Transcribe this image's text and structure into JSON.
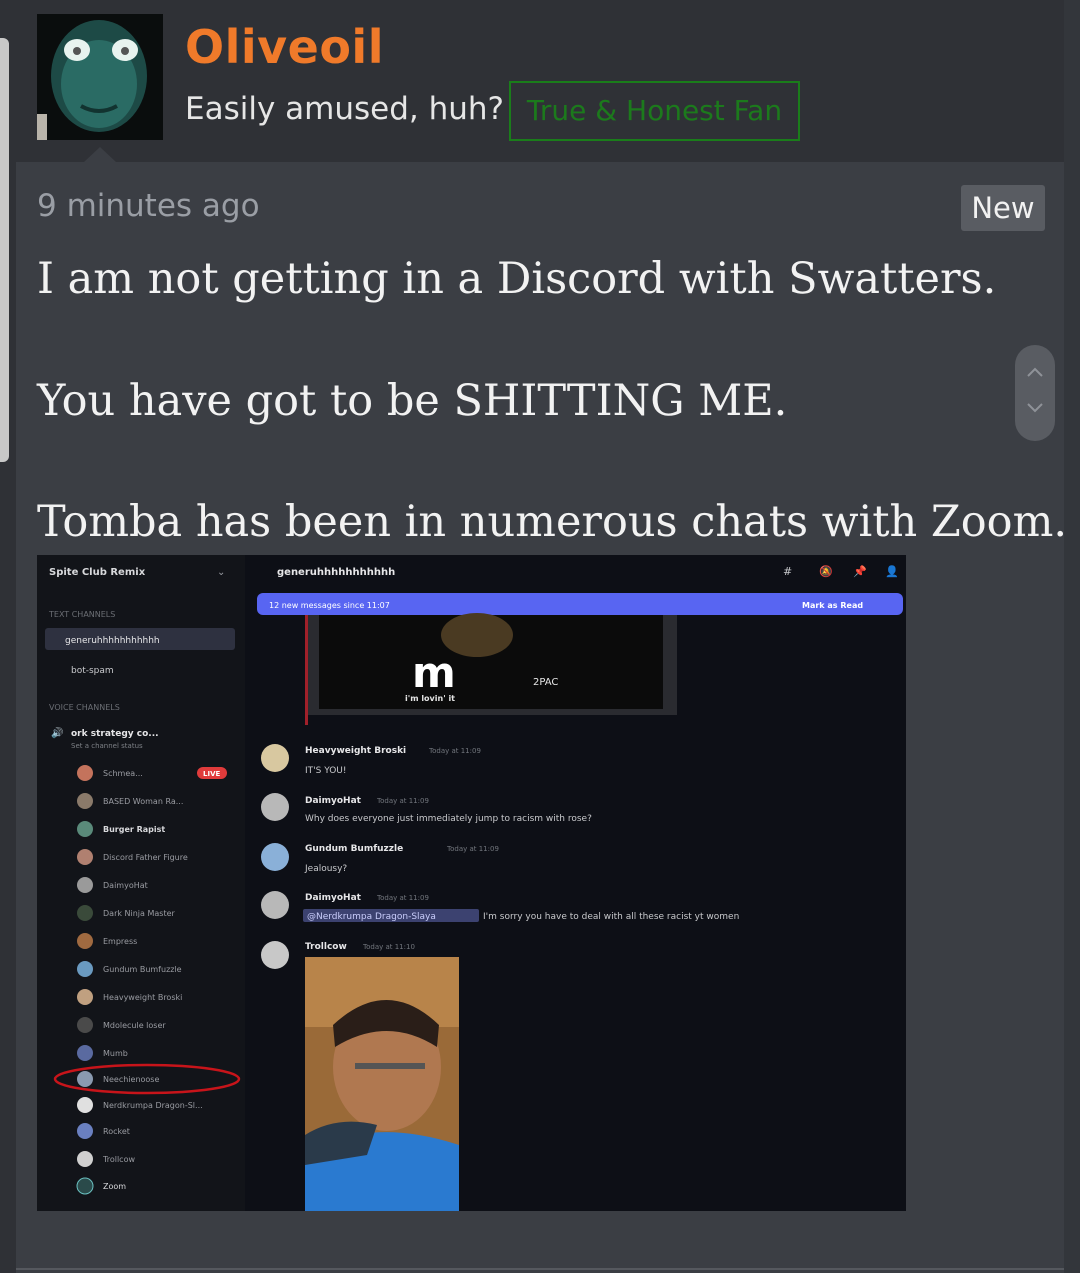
{
  "post": {
    "username": "Oliveoil",
    "user_title": "Easily amused, huh?",
    "banner": "True & Honest Fan",
    "timestamp": "9 minutes ago",
    "new_badge": "New",
    "lines": [
      "I am not getting in a Discord with Swatters.",
      "You have got to be SHITTING ME.",
      "Tomba has been in numerous chats with Zoom."
    ]
  },
  "screenshot": {
    "server_name": "Spite Club Remix",
    "channel_name": "generuhhhhhhhhhhh",
    "new_messages_bar": "12 new messages since 11:07",
    "mark_as_read": "Mark as Read",
    "text_channels_header": "TEXT CHANNELS",
    "voice_channels_header": "VOICE CHANNELS",
    "text_channels": [
      "generuhhhhhhhhhhh",
      "bot-spam"
    ],
    "voice_channel": "ork strategy co...",
    "voice_channel_status": "Set a channel status",
    "live_badge": "LIVE",
    "voice_members": [
      "Schmea...",
      "BASED Woman Ra...",
      "Burger Rapist",
      "Discord Father Figure",
      "DaimyoHat",
      "Dark Ninja Master",
      "Empress",
      "Gundum Bumfuzzle",
      "Heavyweight Broski",
      "Mdolecule loser",
      "Mumb",
      "Neechienoose",
      "Nerdkrumpa Dragon-Sl...",
      "Rocket",
      "Trollcow",
      "Zoom"
    ],
    "ad_tagline": "i'm lovin' it",
    "ad_side_text": "2PAC",
    "messages": [
      {
        "author": "Heavyweight Broski",
        "time": "Today at 11:09",
        "text": "IT'S YOU!"
      },
      {
        "author": "DaimyoHat",
        "time": "Today at 11:09",
        "text": "Why does everyone just immediately jump to racism with rose?"
      },
      {
        "author": "Gundum Bumfuzzle",
        "time": "Today at 11:09",
        "text": "Jealousy?"
      },
      {
        "author": "DaimyoHat",
        "time": "Today at 11:09",
        "mention": "@Nerdkrumpa Dragon-Slaya",
        "text": "I'm sorry you have to deal with all these racist yt women"
      },
      {
        "author": "Trollcow",
        "time": "Today at 11:10",
        "text": ""
      }
    ]
  }
}
